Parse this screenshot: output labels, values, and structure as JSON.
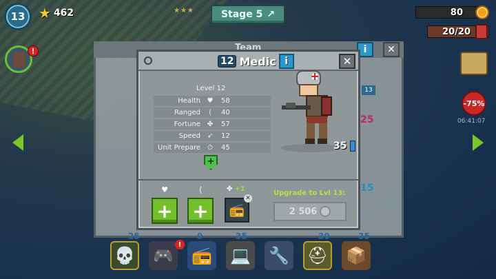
{
  "top": {
    "player_level": "13",
    "stars": "462",
    "stage_label": "Stage 5",
    "coins": "80",
    "energy": "20/20"
  },
  "side": {
    "discount": "-75%",
    "timer": "06:41:07"
  },
  "background_panel": {
    "title": "Team",
    "badge_number": "13",
    "numbers": [
      "25",
      "15",
      "25",
      "9",
      "35",
      "30",
      "35"
    ]
  },
  "dialog": {
    "level_chip": "12",
    "title": "Medic",
    "level_text": "Level 12",
    "stats": [
      {
        "name": "Health",
        "icon": "heart-icon",
        "glyph": "♥",
        "value": "58"
      },
      {
        "name": "Ranged",
        "icon": "bow-icon",
        "glyph": "⟨",
        "value": "40"
      },
      {
        "name": "Fortune",
        "icon": "clover-icon",
        "glyph": "✤",
        "value": "57"
      },
      {
        "name": "Speed",
        "icon": "boot-icon",
        "glyph": "➶",
        "value": "12"
      },
      {
        "name": "Unit Prepare",
        "icon": "stopwatch-icon",
        "glyph": "⏱",
        "value": "45"
      }
    ],
    "unit_count": "35",
    "fortune_bonus": "+1",
    "upgrade_label": "Upgrade to Lvl 13:",
    "upgrade_cost": "2 506"
  },
  "colors": {
    "accent_green": "#72c02c",
    "panel_grey": "#8f9799",
    "info_blue": "#2a98c8"
  }
}
